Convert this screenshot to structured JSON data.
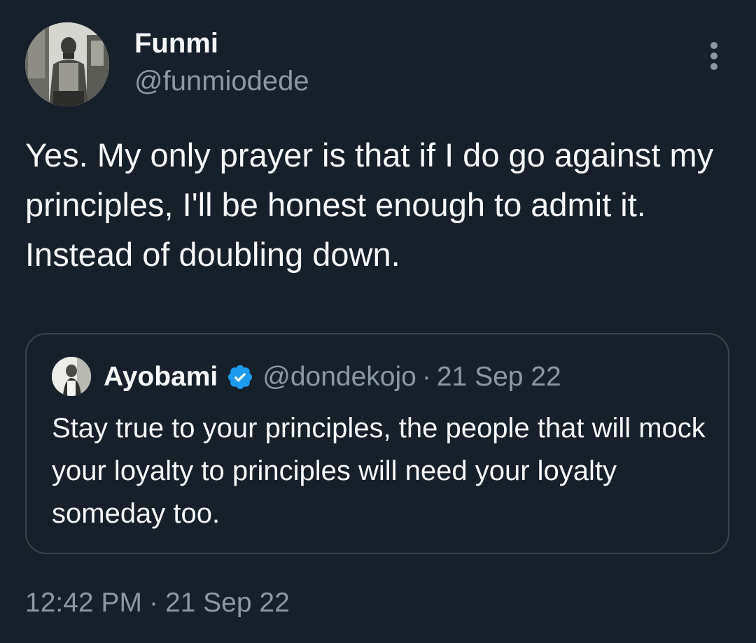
{
  "author": {
    "display_name": "Funmi",
    "handle": "@funmiodede"
  },
  "tweet": {
    "text": "Yes. My only prayer is that if I do go against my principles, I'll be honest enough to admit it. Instead of doubling down."
  },
  "quoted_tweet": {
    "display_name": "Ayobami",
    "handle": "@dondekojo",
    "separator": "·",
    "date": "21 Sep 22",
    "verified": true,
    "text": "Stay true to your principles, the people that will mock your loyalty to principles will need your loyalty someday too."
  },
  "meta": {
    "time": "12:42 PM",
    "separator": "·",
    "date": "21 Sep 22"
  },
  "icons": {
    "more": "more-vertical-icon",
    "verified": "verified-badge-icon"
  },
  "colors": {
    "background": "#15202b",
    "primary_text": "#f7f9f9",
    "secondary_text": "#8b98a5",
    "border": "#38444d",
    "verified_blue": "#1d9bf0"
  }
}
